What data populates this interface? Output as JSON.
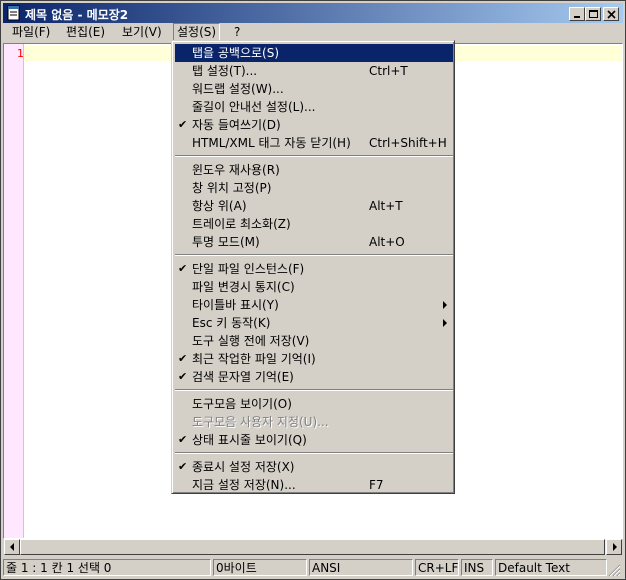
{
  "titlebar": {
    "title": "제목 없음 - 메모장2",
    "minimize_icon": "minimize-icon",
    "maximize_icon": "maximize-icon",
    "close_icon": "close-icon"
  },
  "menubar": {
    "file": "파일(F)",
    "edit": "편집(E)",
    "view": "보기(V)",
    "settings": "설정(S)",
    "help": "?"
  },
  "editor": {
    "line_number": "1"
  },
  "settings_menu": {
    "items": [
      {
        "label": "탭을 공백으로(S)",
        "shortcut": "",
        "checked": false,
        "submenu": false,
        "highlighted": true,
        "disabled": false
      },
      {
        "label": "탭 설정(T)...",
        "shortcut": "Ctrl+T",
        "checked": false,
        "submenu": false,
        "highlighted": false,
        "disabled": false
      },
      {
        "label": "워드랩 설정(W)...",
        "shortcut": "",
        "checked": false,
        "submenu": false,
        "highlighted": false,
        "disabled": false
      },
      {
        "label": "줄길이 안내선 설정(L)...",
        "shortcut": "",
        "checked": false,
        "submenu": false,
        "highlighted": false,
        "disabled": false
      },
      {
        "label": "자동 들여쓰기(D)",
        "shortcut": "",
        "checked": true,
        "submenu": false,
        "highlighted": false,
        "disabled": false
      },
      {
        "label": "HTML/XML 태그 자동 닫기(H)",
        "shortcut": "Ctrl+Shift+H",
        "checked": false,
        "submenu": false,
        "highlighted": false,
        "disabled": false
      },
      {
        "label": "윈도우 재사용(R)",
        "shortcut": "",
        "checked": false,
        "submenu": false,
        "highlighted": false,
        "disabled": false
      },
      {
        "label": "창 위치 고정(P)",
        "shortcut": "",
        "checked": false,
        "submenu": false,
        "highlighted": false,
        "disabled": false
      },
      {
        "label": "항상 위(A)",
        "shortcut": "Alt+T",
        "checked": false,
        "submenu": false,
        "highlighted": false,
        "disabled": false
      },
      {
        "label": "트레이로 최소화(Z)",
        "shortcut": "",
        "checked": false,
        "submenu": false,
        "highlighted": false,
        "disabled": false
      },
      {
        "label": "투명 모드(M)",
        "shortcut": "Alt+O",
        "checked": false,
        "submenu": false,
        "highlighted": false,
        "disabled": false
      },
      {
        "label": "단일 파일 인스턴스(F)",
        "shortcut": "",
        "checked": true,
        "submenu": false,
        "highlighted": false,
        "disabled": false
      },
      {
        "label": "파일 변경시 통지(C)",
        "shortcut": "",
        "checked": false,
        "submenu": false,
        "highlighted": false,
        "disabled": false
      },
      {
        "label": "타이틀바 표시(Y)",
        "shortcut": "",
        "checked": false,
        "submenu": true,
        "highlighted": false,
        "disabled": false
      },
      {
        "label": "Esc 키 동작(K)",
        "shortcut": "",
        "checked": false,
        "submenu": true,
        "highlighted": false,
        "disabled": false
      },
      {
        "label": "도구 실행 전에 저장(V)",
        "shortcut": "",
        "checked": false,
        "submenu": false,
        "highlighted": false,
        "disabled": false
      },
      {
        "label": "최근 작업한 파일 기억(I)",
        "shortcut": "",
        "checked": true,
        "submenu": false,
        "highlighted": false,
        "disabled": false
      },
      {
        "label": "검색 문자열 기억(E)",
        "shortcut": "",
        "checked": true,
        "submenu": false,
        "highlighted": false,
        "disabled": false
      },
      {
        "label": "도구모음 보이기(O)",
        "shortcut": "",
        "checked": false,
        "submenu": false,
        "highlighted": false,
        "disabled": false
      },
      {
        "label": "도구모음 사용자 지정(U)...",
        "shortcut": "",
        "checked": false,
        "submenu": false,
        "highlighted": false,
        "disabled": true
      },
      {
        "label": "상태 표시줄 보이기(Q)",
        "shortcut": "",
        "checked": true,
        "submenu": false,
        "highlighted": false,
        "disabled": false
      },
      {
        "label": "종료시 설정 저장(X)",
        "shortcut": "",
        "checked": true,
        "submenu": false,
        "highlighted": false,
        "disabled": false
      },
      {
        "label": "지금 설정 저장(N)...",
        "shortcut": "F7",
        "checked": false,
        "submenu": false,
        "highlighted": false,
        "disabled": false
      }
    ]
  },
  "statusbar": {
    "position": "줄 1 : 1   칸 1   선택 0",
    "size": "0바이트",
    "encoding": "ANSI",
    "line_ending": "CR+LF",
    "insert_mode": "INS",
    "lexer": "Default Text"
  },
  "colors": {
    "title_gradient_start": "#0a246a",
    "title_gradient_end": "#a6caf0",
    "menu_highlight": "#0a246a",
    "gutter": "#ffe8ff",
    "current_line": "#ffffd8",
    "line_number": "#ff0000"
  }
}
